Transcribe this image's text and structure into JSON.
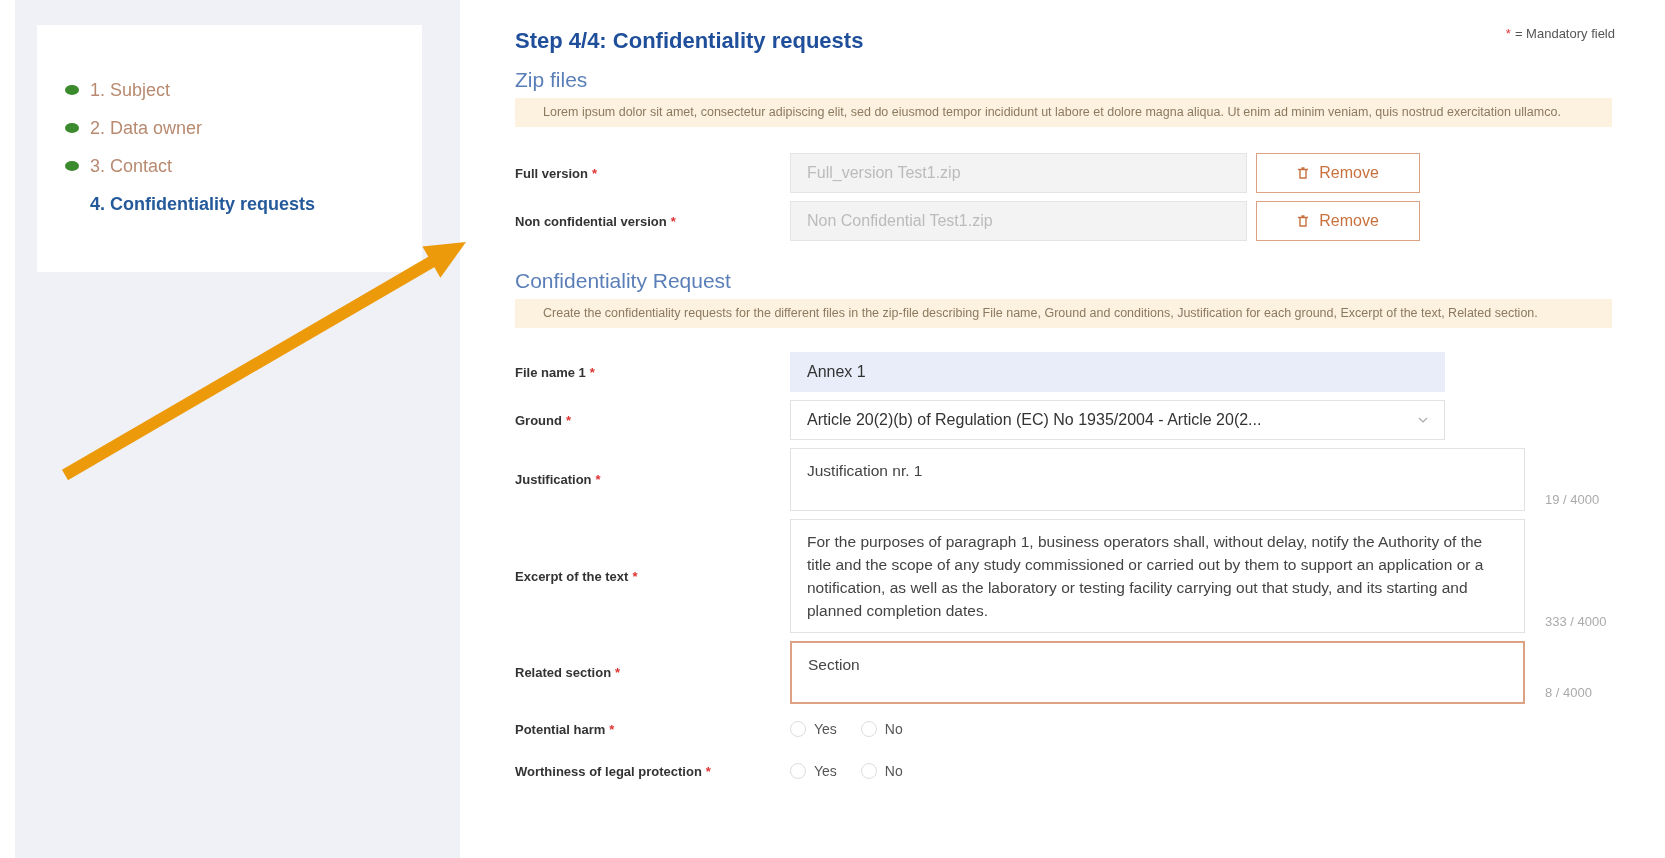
{
  "steps": [
    {
      "label": "1. Subject",
      "completed": true,
      "selected": false
    },
    {
      "label": "2. Data owner",
      "completed": true,
      "selected": false
    },
    {
      "label": "3. Contact",
      "completed": true,
      "selected": false
    },
    {
      "label": "4. Confidentiality requests",
      "completed": false,
      "selected": true
    }
  ],
  "form": {
    "title": "Step 4/4: Confidentiality requests",
    "mandatory_note": {
      "mark": "*",
      "text": "= Mandatory field"
    },
    "zip_section": {
      "heading": "Zip files",
      "notice": "Lorem ipsum dolor sit amet, consectetur adipiscing elit, sed do eiusmod tempor incididunt ut labore et dolore magna aliqua. Ut enim ad minim veniam, quis nostrud exercitation ullamco.",
      "files": [
        {
          "label": "Full version",
          "required_mark": "*",
          "value": "Full_version Test1.zip",
          "button": "Remove"
        },
        {
          "label": "Non confidential version",
          "required_mark": "*",
          "value": "Non Confidential Test1.zip",
          "button": "Remove"
        }
      ]
    },
    "request_section": {
      "heading": "Confidentiality Request",
      "notice": "Create the confidentiality requests for the different files in the zip-file describing File name, Ground and conditions, Justification for each ground, Excerpt of the text, Related section.",
      "fields": [
        {
          "kind": "input",
          "label": "File name 1",
          "required_mark": "*",
          "value": "Annex 1",
          "focused": false
        },
        {
          "kind": "select",
          "label": "Ground",
          "required_mark": "*",
          "value": "Article 20(2)(b) of Regulation (EC) No 1935/2004 - Article 20(2...",
          "focused": false
        },
        {
          "kind": "textarea",
          "label": "Justification",
          "required_mark": "*",
          "value": "Justification nr. 1",
          "counter": "19 / 4000",
          "focused": false
        },
        {
          "kind": "textarea",
          "label": "Excerpt of the text",
          "required_mark": "*",
          "value": "For the purposes of paragraph 1, business operators shall, without delay, notify the Authority of the title and the scope of any study commissioned or carried out by them to support an application or a notification, as well as the laboratory or testing facility carrying out that study, and its starting and planned completion dates.",
          "counter": "333 / 4000",
          "focused": false
        },
        {
          "kind": "textarea",
          "label": "Related section",
          "required_mark": "*",
          "value": "Section",
          "counter": "8 / 4000",
          "focused": true
        },
        {
          "kind": "radio",
          "label": "Potential harm",
          "required_mark": "*",
          "options": [
            {
              "label": "Yes",
              "checked": false
            },
            {
              "label": "No",
              "checked": false
            }
          ]
        },
        {
          "kind": "radio",
          "label": "Worthiness of legal protection",
          "required_mark": "*",
          "options": [
            {
              "label": "Yes",
              "checked": false
            },
            {
              "label": "No",
              "checked": false
            }
          ]
        }
      ]
    }
  }
}
